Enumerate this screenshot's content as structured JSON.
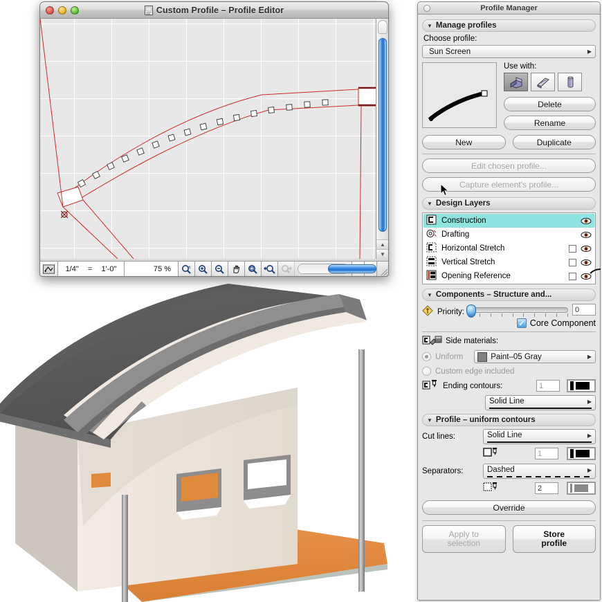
{
  "profile_editor": {
    "title": "Custom Profile – Profile Editor",
    "doc_icon": "document-icon",
    "traffic_lights": [
      "close-button",
      "minimize-button",
      "zoom-button"
    ],
    "status_bar": {
      "layer_icon": "layer-scale-icon",
      "scale_left": "1/4\"",
      "scale_eq": "=",
      "scale_right": "1'-0\"",
      "zoom_percent": "75 %",
      "tools": [
        "zoom-set-icon",
        "zoom-in-icon",
        "zoom-out-icon",
        "pan-hand-icon",
        "fit-to-window-icon",
        "zoom-previous-icon",
        "zoom-next-icon"
      ],
      "scroll_left_arrow": "◀",
      "scroll_right_arrow": "▶"
    }
  },
  "profile_manager": {
    "title": "Profile Manager",
    "close_icon": "close-icon",
    "manage_profiles": {
      "header": "Manage profiles",
      "choose_profile_label": "Choose profile:",
      "selected_profile": "Sun Screen",
      "preview_name": "profile-preview",
      "use_with_label": "Use with:",
      "use_with_icons": [
        "wall-icon",
        "beam-icon",
        "column-icon"
      ],
      "use_with_selected_index": 0,
      "delete_label": "Delete",
      "rename_label": "Rename",
      "new_label": "New",
      "duplicate_label": "Duplicate",
      "edit_chosen_profile_label": "Edit chosen profile...",
      "capture_element_profile_label": "Capture element's profile..."
    },
    "design_layers": {
      "header": "Design Layers",
      "columns": [
        "icon",
        "name",
        "checkbox",
        "visibility"
      ],
      "rows": [
        {
          "icon": "construction-layer-icon",
          "name": "Construction",
          "has_checkbox": false,
          "checked": false,
          "visible": true,
          "selected": true
        },
        {
          "icon": "drafting-layer-icon",
          "name": "Drafting",
          "has_checkbox": false,
          "checked": false,
          "visible": true,
          "selected": false
        },
        {
          "icon": "horizontal-stretch-layer-icon",
          "name": "Horizontal Stretch",
          "has_checkbox": true,
          "checked": false,
          "visible": true,
          "selected": false
        },
        {
          "icon": "vertical-stretch-layer-icon",
          "name": "Vertical Stretch",
          "has_checkbox": true,
          "checked": false,
          "visible": true,
          "selected": false
        },
        {
          "icon": "opening-reference-layer-icon",
          "name": "Opening Reference",
          "has_checkbox": true,
          "checked": false,
          "visible": true,
          "selected": false
        }
      ]
    },
    "components": {
      "header": "Components – Structure and...",
      "priority_icon": "priority-diamond-icon",
      "priority_label": "Priority:",
      "priority_value": "0",
      "priority_slider_pct": 0,
      "core_component_label": "Core Component",
      "core_component_checked": true,
      "side_materials_icon": "side-materials-icon",
      "side_materials_label": "Side materials:",
      "uniform_label": "Uniform",
      "uniform_selected": true,
      "uniform_enabled": false,
      "material_swatch_color": "#808080",
      "material_name": "Paint–05 Gray",
      "custom_edge_label": "Custom edge included",
      "custom_edge_selected": false,
      "ending_contours_icon": "ending-contours-icon",
      "ending_contours_label": "Ending contours:",
      "ending_contours_pen": "1",
      "ending_contours_line": "Solid Line"
    },
    "profile_uniform_contours": {
      "header": "Profile – uniform contours",
      "cut_lines_label": "Cut lines:",
      "cut_lines_value": "Solid Line",
      "cut_lines_fill_icon": "empty-square-icon",
      "cut_lines_pen_icon": "pen-icon",
      "cut_lines_pen": "1",
      "separators_label": "Separators:",
      "separators_value": "Dashed",
      "separators_fill_icon": "dotted-square-icon",
      "separators_pen_icon": "pen-icon",
      "separators_pen": "2",
      "override_label": "Override"
    },
    "footer": {
      "apply_to_selection_label": "Apply to\nselection",
      "apply_to_selection_line1": "Apply to",
      "apply_to_selection_line2": "selection",
      "apply_enabled": false,
      "store_profile_line1": "Store",
      "store_profile_line2": "profile"
    }
  },
  "colors": {
    "palette_bg": "#e7e7e7",
    "selection_highlight": "#8fe4e0",
    "profile_line": "#cc2b2b",
    "canvas_bg": "#e8e8e8",
    "roof_dark": "#5a5a5a",
    "roof_mid": "#9b9b9b",
    "wall": "#efe6dd",
    "deck_orange": "#e08a3c"
  },
  "model_3d": {
    "name": "sun-screen-canopy-model",
    "description": "3D shaded view of a building with a curved sun screen canopy, slatted roof, two columns, two windows and an orange deck."
  }
}
